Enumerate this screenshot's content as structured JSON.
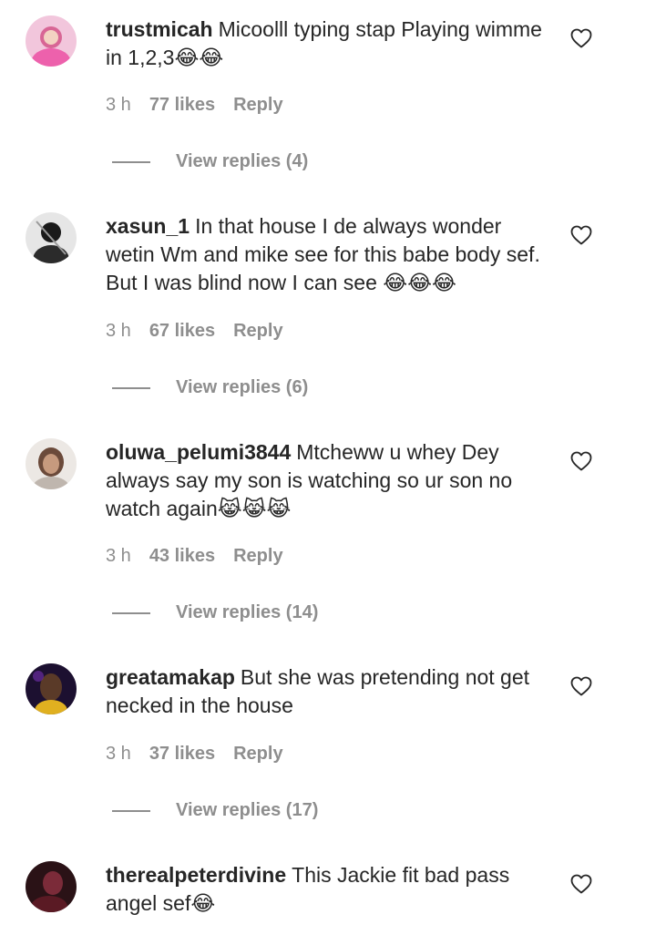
{
  "comments": [
    {
      "username": "trustmicah",
      "text": "Micoolll typing stap Playing wimme in 1,2,3😂😂",
      "time": "3 h",
      "likes": "77 likes",
      "reply": "Reply",
      "view_replies": "View replies (4)",
      "avatar_colors": [
        "#e8a7c9",
        "#c2185b"
      ]
    },
    {
      "username": "xasun_1",
      "text": "In that house I de always wonder wetin Wm and mike see for this babe body sef. But I was blind now I can see 😂😂😂",
      "time": "3 h",
      "likes": "67 likes",
      "reply": "Reply",
      "view_replies": "View replies (6)",
      "avatar_colors": [
        "#d9d9d9",
        "#1a1a1a"
      ]
    },
    {
      "username": "oluwa_pelumi3844",
      "text": "Mtcheww u whey Dey always say my son is watching so ur son no watch again😹😹😹",
      "time": "3 h",
      "likes": "43 likes",
      "reply": "Reply",
      "view_replies": "View replies (14)",
      "avatar_colors": [
        "#e9e4e0",
        "#6b4a3a"
      ]
    },
    {
      "username": "greatamakap",
      "text": "But she was pretending not get necked in the house",
      "time": "3 h",
      "likes": "37 likes",
      "reply": "Reply",
      "view_replies": "View replies (17)",
      "avatar_colors": [
        "#1c1030",
        "#e0b020"
      ]
    },
    {
      "username": "therealpeterdivine",
      "text": "This Jackie fit bad pass angel sef😂",
      "avatar_colors": [
        "#2a1216",
        "#8a3040"
      ]
    }
  ],
  "icons": {
    "like": "heart-outline-icon"
  }
}
